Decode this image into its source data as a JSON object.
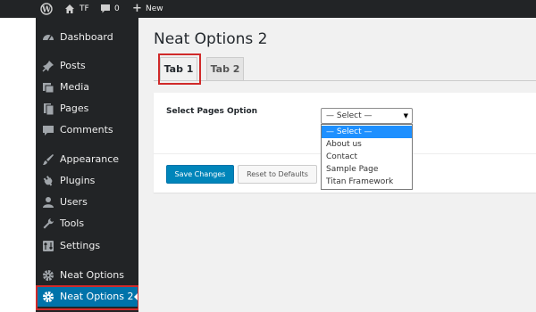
{
  "admin_bar": {
    "site_name": "TF",
    "comments_count": "0",
    "new_label": "New"
  },
  "sidebar": {
    "items": [
      {
        "label": "Dashboard",
        "icon": "dashboard-icon"
      },
      {
        "label": "Posts",
        "icon": "pin-icon"
      },
      {
        "label": "Media",
        "icon": "media-icon"
      },
      {
        "label": "Pages",
        "icon": "pages-icon"
      },
      {
        "label": "Comments",
        "icon": "comment-icon"
      },
      {
        "label": "Appearance",
        "icon": "brush-icon"
      },
      {
        "label": "Plugins",
        "icon": "plug-icon"
      },
      {
        "label": "Users",
        "icon": "user-icon"
      },
      {
        "label": "Tools",
        "icon": "wrench-icon"
      },
      {
        "label": "Settings",
        "icon": "settings-icon"
      },
      {
        "label": "Neat Options",
        "icon": "gear-icon"
      },
      {
        "label": "Neat Options 2",
        "icon": "gear-icon",
        "current": true
      }
    ]
  },
  "main": {
    "title": "Neat Options 2",
    "tabs": [
      {
        "label": "Tab 1",
        "active": true
      },
      {
        "label": "Tab 2",
        "active": false
      }
    ],
    "field": {
      "label": "Select Pages Option",
      "selected_value": "— Select —",
      "options": [
        "— Select —",
        "About us",
        "Contact",
        "Sample Page",
        "Titan Framework"
      ]
    },
    "buttons": {
      "save_label": "Save Changes",
      "reset_label": "Reset to Defaults"
    }
  },
  "colors": {
    "admin_dark": "#222426",
    "accent_blue": "#0073aa",
    "button_blue": "#0085ba",
    "highlight_red": "#d02a2a",
    "content_bg": "#f1f1f1"
  }
}
